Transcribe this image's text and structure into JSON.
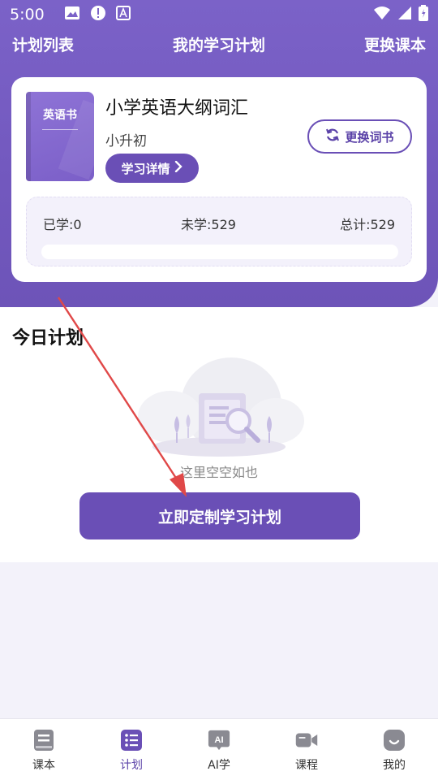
{
  "status_bar": {
    "time": "5:00",
    "icons": [
      "image-icon",
      "alert-icon",
      "font-icon",
      "wifi-icon",
      "signal-icon",
      "battery-icon"
    ]
  },
  "top_nav": {
    "left": "计划列表",
    "title": "我的学习计划",
    "right": "更换课本"
  },
  "book": {
    "cover_label": "英语书",
    "title": "小学英语大纲词汇",
    "level": "小升初",
    "detail_button": "学习详情",
    "change_button": "更换词书"
  },
  "stats": {
    "learned": "已学:0",
    "unlearned": "未学:529",
    "total": "总计:529",
    "progress_fraction": 0
  },
  "today": {
    "title": "今日计划",
    "empty_text": "这里空空如也",
    "custom_button": "立即定制学习计划"
  },
  "bottom_nav": {
    "items": [
      {
        "label": "课本",
        "icon": "book-icon"
      },
      {
        "label": "计划",
        "icon": "list-icon"
      },
      {
        "label": "AI学",
        "icon": "ai-chat-icon"
      },
      {
        "label": "课程",
        "icon": "video-icon"
      },
      {
        "label": "我的",
        "icon": "profile-icon"
      }
    ],
    "active_index": 1
  },
  "colors": {
    "brand": "#6a4fb6",
    "header": "#7b62c8",
    "annotation_arrow": "#e04848"
  }
}
